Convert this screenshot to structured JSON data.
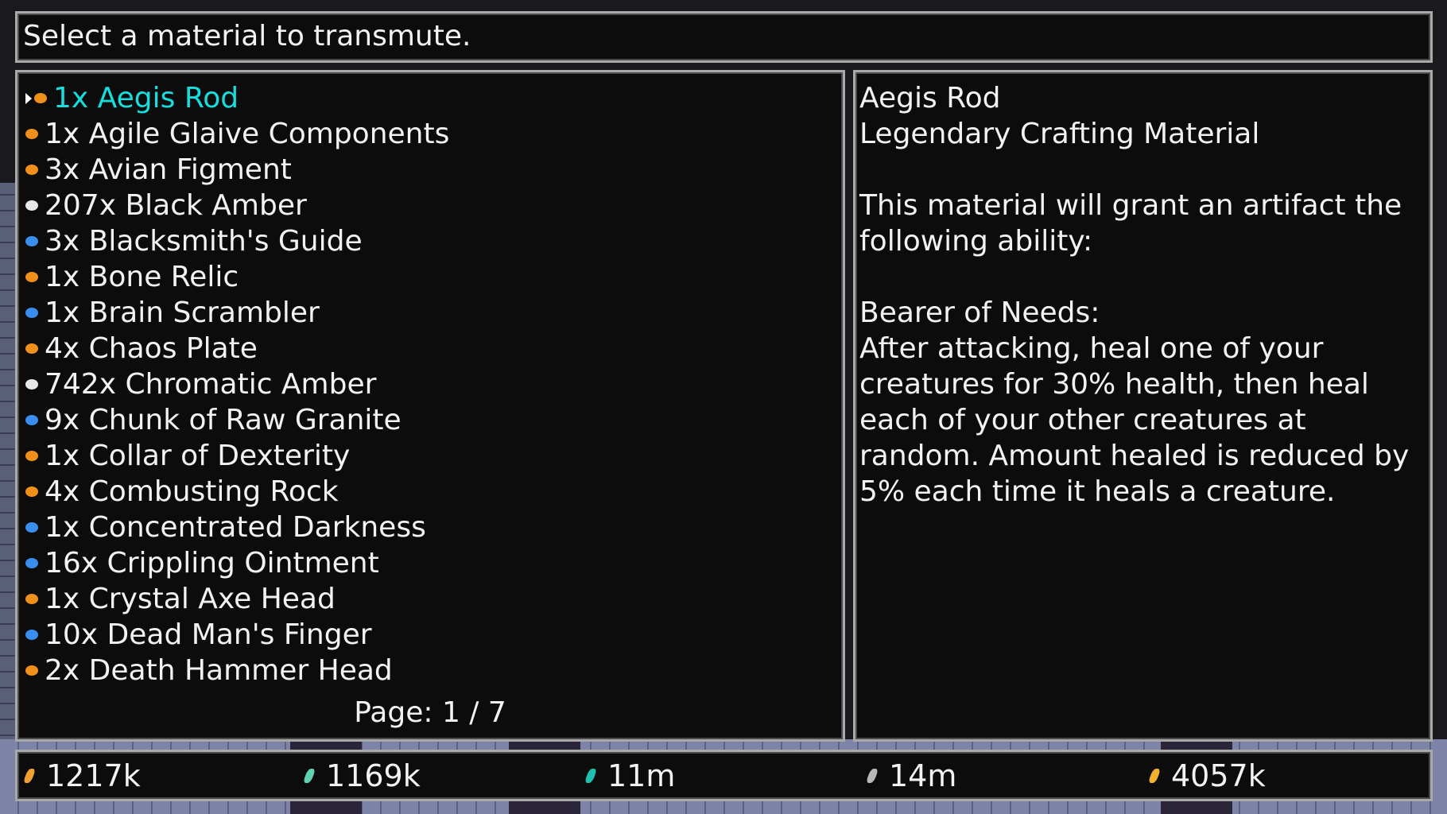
{
  "prompt": "Select a material to transmute.",
  "list": {
    "items": [
      {
        "label": "1x Aegis Rod",
        "gem": "#f0901a",
        "selected": true
      },
      {
        "label": "1x Agile Glaive Components",
        "gem": "#f0901a"
      },
      {
        "label": "3x Avian Figment",
        "gem": "#f0901a"
      },
      {
        "label": "207x Black Amber",
        "gem": "#e8e8e8"
      },
      {
        "label": "3x Blacksmith's Guide",
        "gem": "#3a8ef0"
      },
      {
        "label": "1x Bone Relic",
        "gem": "#f0901a"
      },
      {
        "label": "1x Brain Scrambler",
        "gem": "#3a8ef0"
      },
      {
        "label": "4x Chaos Plate",
        "gem": "#f0901a"
      },
      {
        "label": "742x Chromatic Amber",
        "gem": "#e8e8e8"
      },
      {
        "label": "9x Chunk of Raw Granite",
        "gem": "#3a8ef0"
      },
      {
        "label": "1x Collar of Dexterity",
        "gem": "#f0901a"
      },
      {
        "label": "4x Combusting Rock",
        "gem": "#f0901a"
      },
      {
        "label": "1x Concentrated Darkness",
        "gem": "#3a8ef0"
      },
      {
        "label": "16x Crippling Ointment",
        "gem": "#3a8ef0"
      },
      {
        "label": "1x Crystal Axe Head",
        "gem": "#f0901a"
      },
      {
        "label": "10x Dead Man's Finger",
        "gem": "#3a8ef0"
      },
      {
        "label": "2x Death Hammer Head",
        "gem": "#f0901a"
      }
    ],
    "page": "Page: 1 / 7"
  },
  "detail": {
    "lines": [
      "Aegis Rod",
      "Legendary Crafting Material",
      "",
      "This material will grant an artifact the",
      "following ability:",
      "",
      "Bearer of Needs:",
      "After attacking, heal one of your",
      "creatures for 30% health, then heal",
      "each of your other creatures at",
      "random. Amount healed is reduced by",
      "5% each time it heals a creature."
    ]
  },
  "resources": [
    {
      "icon": "gold-shard-icon",
      "value": "1217k",
      "color": "#f0a030"
    },
    {
      "icon": "teal-shard-icon",
      "value": "1169k",
      "color": "#5fd0b0"
    },
    {
      "icon": "crystal-shard-icon",
      "value": "11m",
      "color": "#20c0b0"
    },
    {
      "icon": "stone-shard-icon",
      "value": "14m",
      "color": "#b8b8b8"
    },
    {
      "icon": "signal-icon",
      "value": "4057k",
      "color": "#f0b030"
    }
  ],
  "colors": {
    "selected": "#16dede",
    "text": "#f2f2f2",
    "panel": "#0c0c0c",
    "border": "#a9a9a9"
  }
}
